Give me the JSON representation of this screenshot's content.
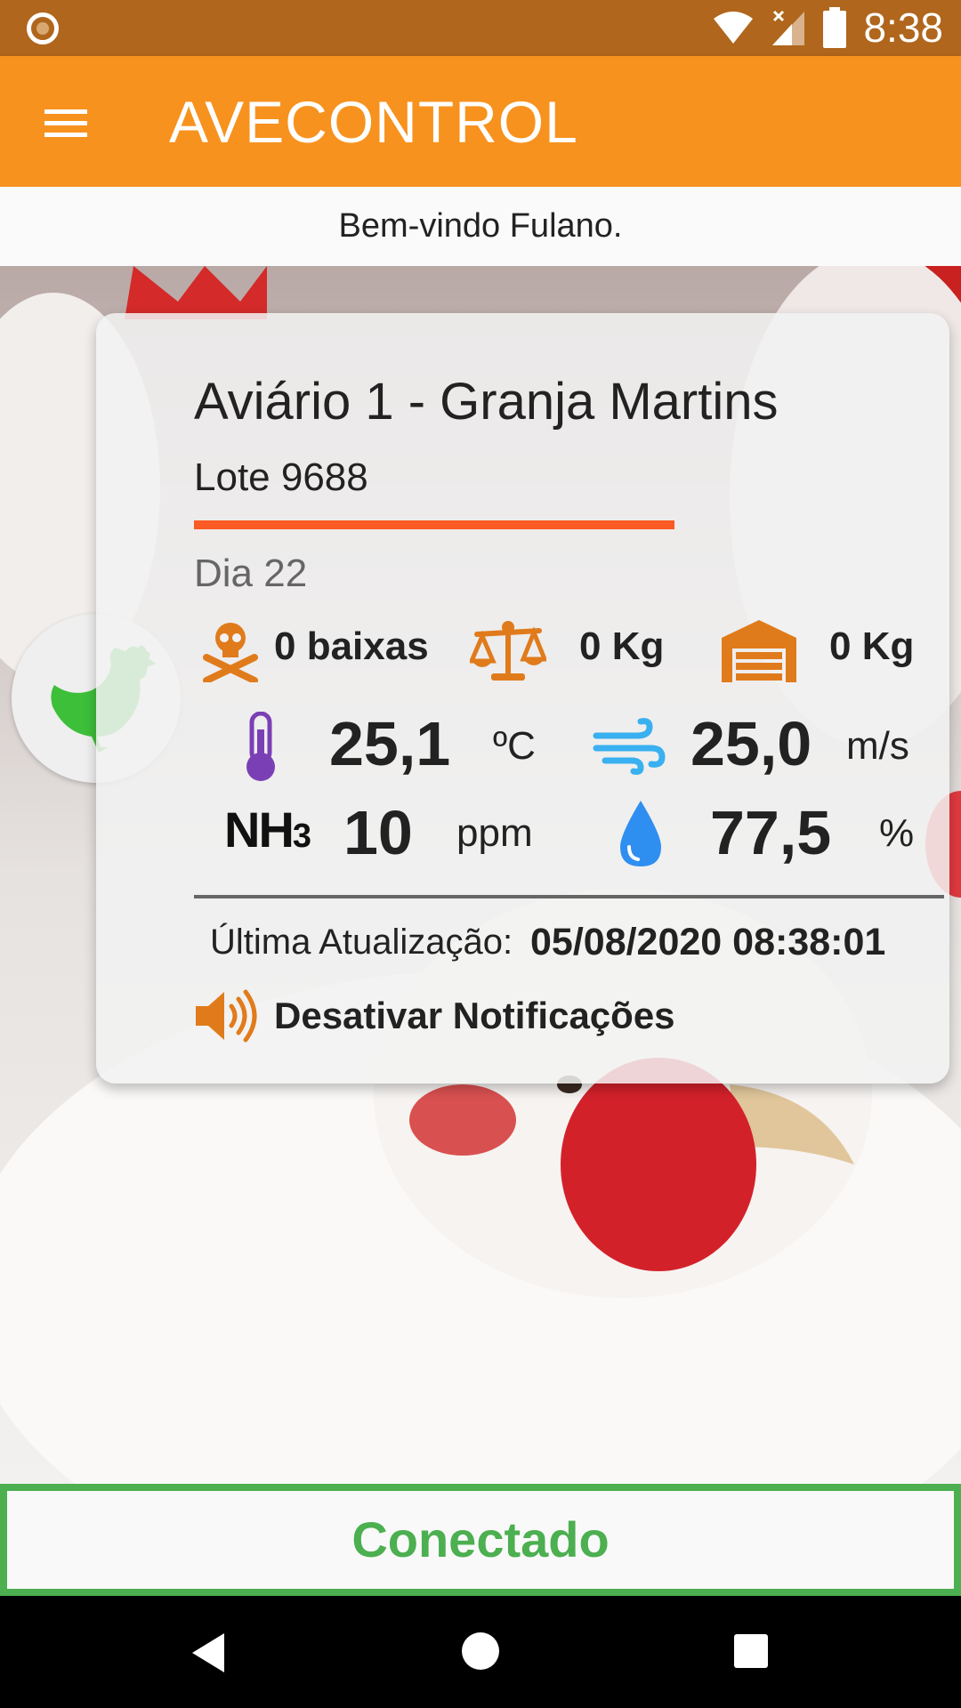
{
  "status_bar": {
    "time": "8:38",
    "icons": [
      "notification-ring-icon",
      "wifi-icon",
      "cell-signal-icon",
      "battery-icon"
    ]
  },
  "app_bar": {
    "menu_icon": "hamburger-menu-icon",
    "title": "AVECONTROL"
  },
  "welcome_text": "Bem-vindo Fulano.",
  "card": {
    "title": "Aviário 1 - Granja Martins",
    "lot": "Lote 9688",
    "day": "Dia 22",
    "mortality": {
      "icon": "skull-crossbones-icon",
      "value": "0 baixas"
    },
    "weight": {
      "icon": "scale-icon",
      "value": "0 Kg"
    },
    "storage": {
      "icon": "warehouse-icon",
      "value": "0 Kg"
    },
    "temperature": {
      "icon": "thermometer-icon",
      "value": "25,1",
      "unit": "ºC"
    },
    "wind": {
      "icon": "wind-icon",
      "value": "25,0",
      "unit": "m/s"
    },
    "ammonia": {
      "label": "NH",
      "sub": "3",
      "value": "10",
      "unit": "ppm"
    },
    "humidity": {
      "icon": "water-drop-icon",
      "value": "77,5",
      "unit": "%"
    },
    "last_update_label": "Última Atualização:",
    "last_update_value": "05/08/2020 08:38:01",
    "notification_label": "Desativar Notificações",
    "notification_icon": "speaker-icon"
  },
  "badge_icon": "hen-icon",
  "connection_status": "Conectado",
  "colors": {
    "status_bar": "#b0661c",
    "app_bar": "#f7921e",
    "accent_line": "#fa5a24",
    "connected": "#4caf50",
    "icon_orange": "#e07b1c",
    "thermo_purple": "#7b3fb5",
    "wind_blue": "#39b0f0",
    "drop_blue": "#2f8ff0",
    "hen_green": "#3dbf3a"
  },
  "nav_bar": [
    "back-icon",
    "home-icon",
    "recents-icon"
  ]
}
